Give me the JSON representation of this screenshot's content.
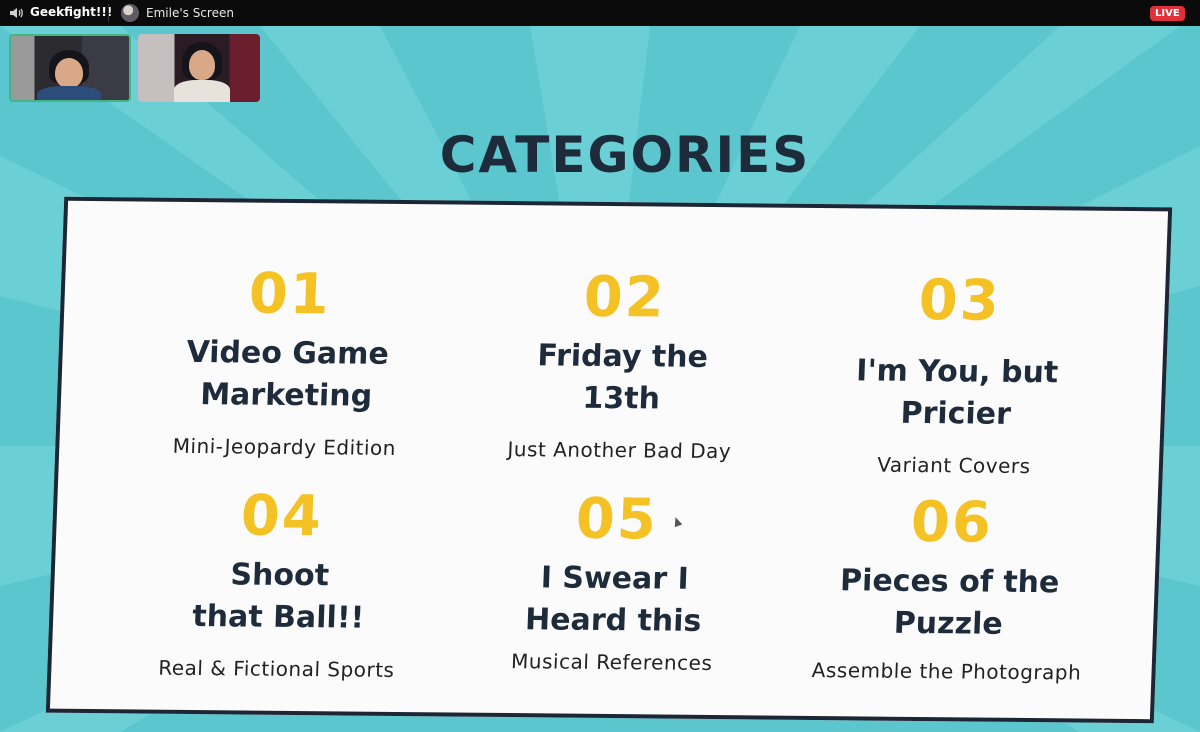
{
  "topbar": {
    "channel_name": "Geekfight!!!",
    "screen_title": "Emile's Screen",
    "live_badge": "LIVE"
  },
  "slide": {
    "title": "CATEGORIES",
    "categories": [
      {
        "number": "01",
        "name_line1": "Video Game",
        "name_line2": "Marketing",
        "subtitle": "Mini-Jeopardy Edition"
      },
      {
        "number": "02",
        "name_line1": "Friday the",
        "name_line2": "13th",
        "subtitle": "Just Another Bad Day"
      },
      {
        "number": "03",
        "name_line1": "I'm You, but",
        "name_line2": "Pricier",
        "subtitle": "Variant Covers"
      },
      {
        "number": "04",
        "name_line1": "Shoot",
        "name_line2": "that Ball!!",
        "subtitle": "Real & Fictional Sports"
      },
      {
        "number": "05",
        "name_line1": "I Swear I",
        "name_line2": "Heard this",
        "subtitle": "Musical References"
      },
      {
        "number": "06",
        "name_line1": "Pieces of the",
        "name_line2": "Puzzle",
        "subtitle": "Assemble the Photograph"
      }
    ]
  },
  "colors": {
    "background_teal": "#5bc6cd",
    "number_yellow": "#f4c224",
    "text_navy": "#1d2b3b",
    "live_red": "#e0313a",
    "speaking_green": "#43b581"
  },
  "icons": {
    "speaker": "speaker-icon",
    "screen_avatar": "user-avatar"
  }
}
